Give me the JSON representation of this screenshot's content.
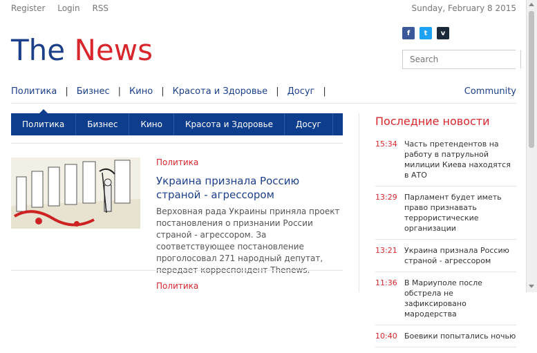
{
  "topbar": {
    "register": "Register",
    "login": "Login",
    "rss": "RSS"
  },
  "date": "Sunday, February 8 2015",
  "logo": {
    "part1": "The",
    "part2": "News"
  },
  "social": [
    {
      "glyph": "f",
      "icon": "facebook-icon",
      "color": "#3b5998"
    },
    {
      "glyph": "t",
      "icon": "twitter-icon",
      "color": "#1da1f2"
    },
    {
      "glyph": "v",
      "icon": "vimeo-icon",
      "color": "#1a2a3a"
    }
  ],
  "search": {
    "placeholder": "Search"
  },
  "nav_main": [
    "Политика",
    "Бизнес",
    "Кино",
    "Красота и Здоровье",
    "Досуг"
  ],
  "community": "Community",
  "nav_tabs": [
    "Политика",
    "Бизнес",
    "Кино",
    "Красота и Здоровье",
    "Досуг"
  ],
  "article1": {
    "category": "Политика",
    "title": "Украина признала Россию страной - агрессором",
    "text": "Верховная рада Украины приняла проект постановления о признании России страной - агрессором. За соответствующее постановление проголосовал 271 народный депутат, передает корреспондент Thenews."
  },
  "article2": {
    "category": "Политика"
  },
  "sidebar": {
    "title": "Последние новости",
    "items": [
      {
        "time": "15:34",
        "headline": "Часть претендентов на работу в патрульной милиции Киева находятся в АТО"
      },
      {
        "time": "13:29",
        "headline": "Парламент будет иметь право признавать террористические организации"
      },
      {
        "time": "13:21",
        "headline": "Украина признала Россию страной - агрессором"
      },
      {
        "time": "11:36",
        "headline": "В Мариуполе после обстрела не зафиксировано мародерства"
      },
      {
        "time": "10:40",
        "headline": "Боевики попытались ночью"
      }
    ]
  },
  "colors": {
    "brand_blue": "#1c3f8a",
    "brand_red": "#d9262c",
    "nav_bg": "#0e3d8e"
  }
}
